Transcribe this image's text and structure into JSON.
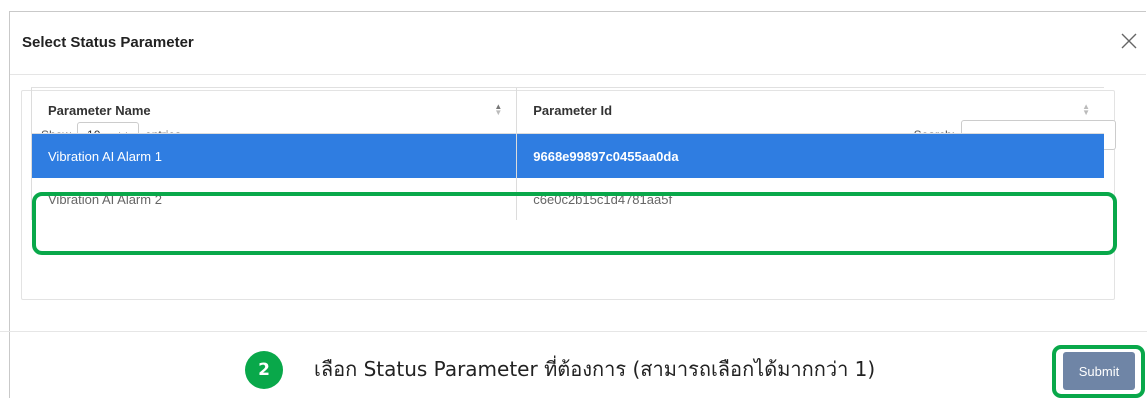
{
  "modal": {
    "title": "Select Status Parameter"
  },
  "table_controls": {
    "show_label": "Show",
    "page_length": "10",
    "entries_label": "entries",
    "search_label": "Search:",
    "search_value": ""
  },
  "table": {
    "columns": [
      "Parameter Name",
      "Parameter Id"
    ],
    "rows": [
      {
        "name": "Vibration AI Alarm 1",
        "id": "9668e99897c0455aa0da",
        "selected": true
      },
      {
        "name": "Vibration AI Alarm 2",
        "id": "c6e0c2b15c1d4781aa5f",
        "selected": false
      }
    ]
  },
  "annotation": {
    "step_number": "2",
    "instruction": "เลือก Status Parameter ที่ต้องการ (สามารถเลือกได้มากกว่า 1)",
    "highlight_color": "#09a84a"
  },
  "footer": {
    "submit_label": "Submit"
  },
  "colors": {
    "selected_row": "#2f7de1",
    "submit_button": "#6f85a6"
  }
}
